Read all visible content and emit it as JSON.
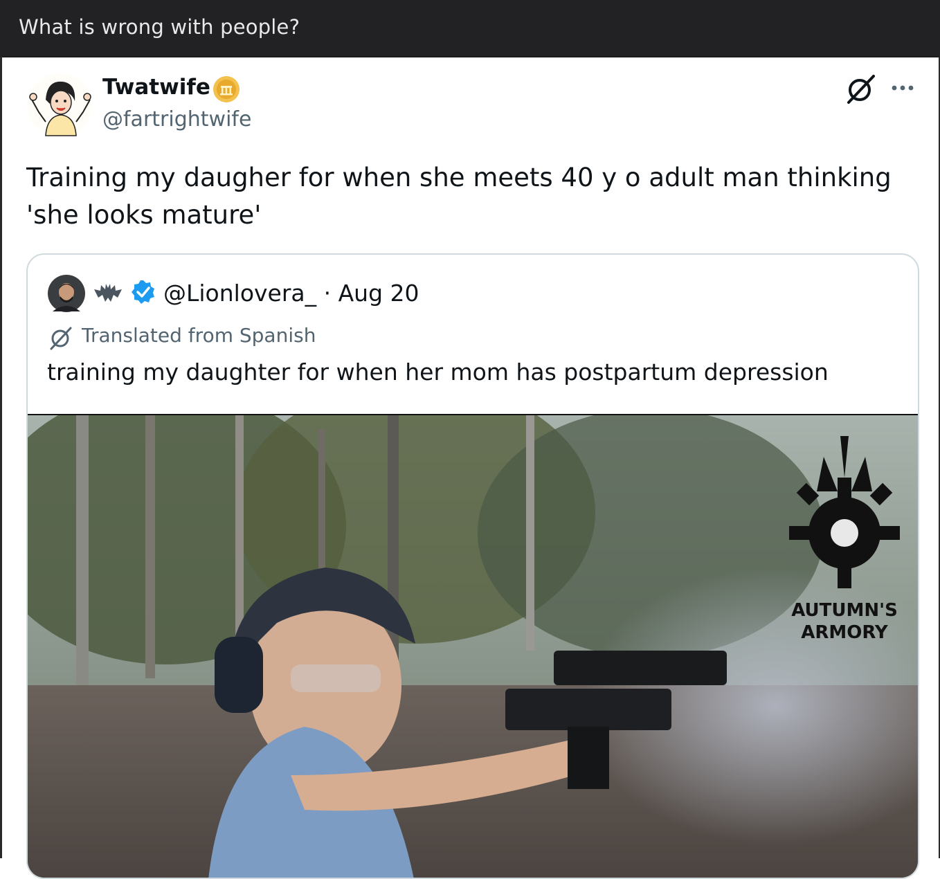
{
  "post": {
    "title": "What is wrong with people?"
  },
  "tweet": {
    "display_name": "Twatwife",
    "handle": "@fartrightwife",
    "text": "Training my daugher for when she meets 40 y o adult man thinking 'she looks mature'",
    "icons": {
      "avatar": "cartoon-woman-avatar",
      "badge": "gold-verified-badge",
      "grok": "grok-icon",
      "more": "more-dots-icon"
    }
  },
  "quoted_tweet": {
    "handle_and_date": "@Lionlovera_ · Aug 20",
    "translated_label": "Translated from Spanish",
    "text": "training my daughter for when her mom has postpartum depression",
    "media": {
      "description_icon": "video-thumbnail",
      "watermark_line1": "AUTUMN'S",
      "watermark_line2": "ARMORY"
    }
  },
  "colors": {
    "topbar": "#222224",
    "secondary_text": "#536471",
    "verified_blue": "#1d9bf0",
    "gold": "#e8b339",
    "border": "#cfd9de"
  }
}
